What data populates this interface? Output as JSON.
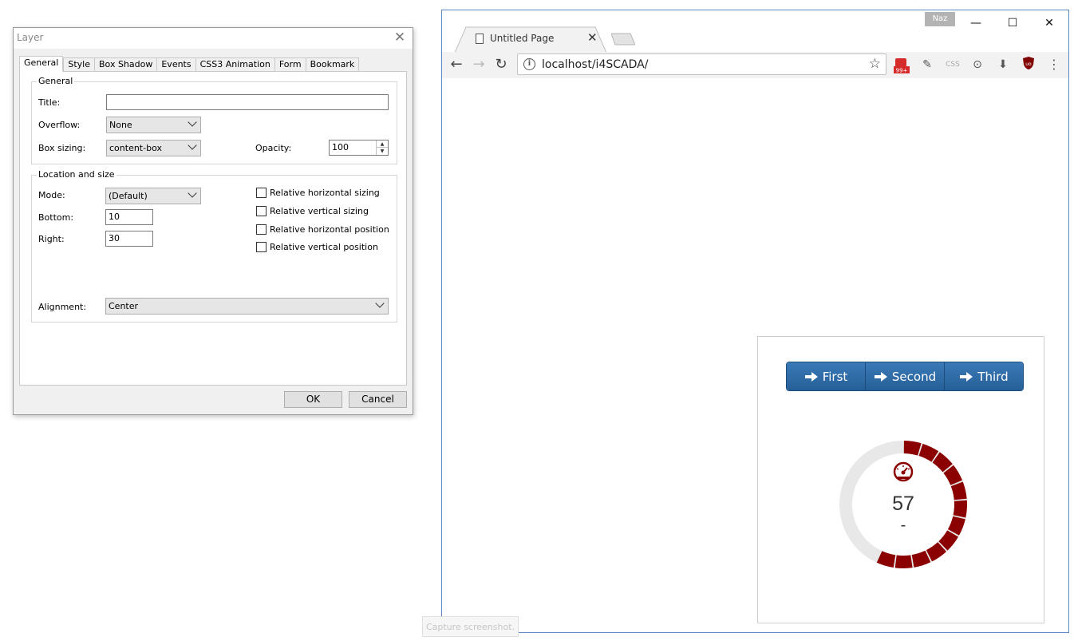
{
  "dialog": {
    "title": "Layer",
    "close_glyph": "✕",
    "tabs": [
      "General",
      "Style",
      "Box Shadow",
      "Events",
      "CSS3 Animation",
      "Form",
      "Bookmark"
    ],
    "active_tab": "General",
    "general": {
      "group_label": "General",
      "title_label": "Title:",
      "title_value": "",
      "overflow_label": "Overflow:",
      "overflow_value": "None",
      "box_sizing_label": "Box sizing:",
      "box_sizing_value": "content-box",
      "opacity_label": "Opacity:",
      "opacity_value": "100"
    },
    "location": {
      "group_label": "Location and size",
      "mode_label": "Mode:",
      "mode_value": "(Default)",
      "bottom_label": "Bottom:",
      "bottom_value": "10",
      "right_label": "Right:",
      "right_value": "30",
      "alignment_label": "Alignment:",
      "alignment_value": "Center",
      "checkboxes": [
        {
          "label": "Relative horizontal sizing",
          "checked": false
        },
        {
          "label": "Relative vertical sizing",
          "checked": false
        },
        {
          "label": "Relative horizontal position",
          "checked": false
        },
        {
          "label": "Relative vertical position",
          "checked": false
        }
      ]
    },
    "ok_label": "OK",
    "cancel_label": "Cancel"
  },
  "browser": {
    "profile_name": "Naz",
    "tab_title": "Untitled Page",
    "url": "localhost/i4SCADA/",
    "extension_badge": "99+",
    "window_controls": {
      "minimize": "—",
      "maximize": "☐",
      "close": "✕"
    },
    "page": {
      "nav_buttons": [
        "First",
        "Second",
        "Third"
      ],
      "button_color": "#2f6ea8",
      "gauge": {
        "value": 57,
        "unit": "-",
        "min": 0,
        "max": 100,
        "segments": 12,
        "active_color": "#8b0000",
        "track_color": "#e8e8e8",
        "icon": "speedometer-icon"
      }
    }
  },
  "capture_hint": "Capture screenshot."
}
